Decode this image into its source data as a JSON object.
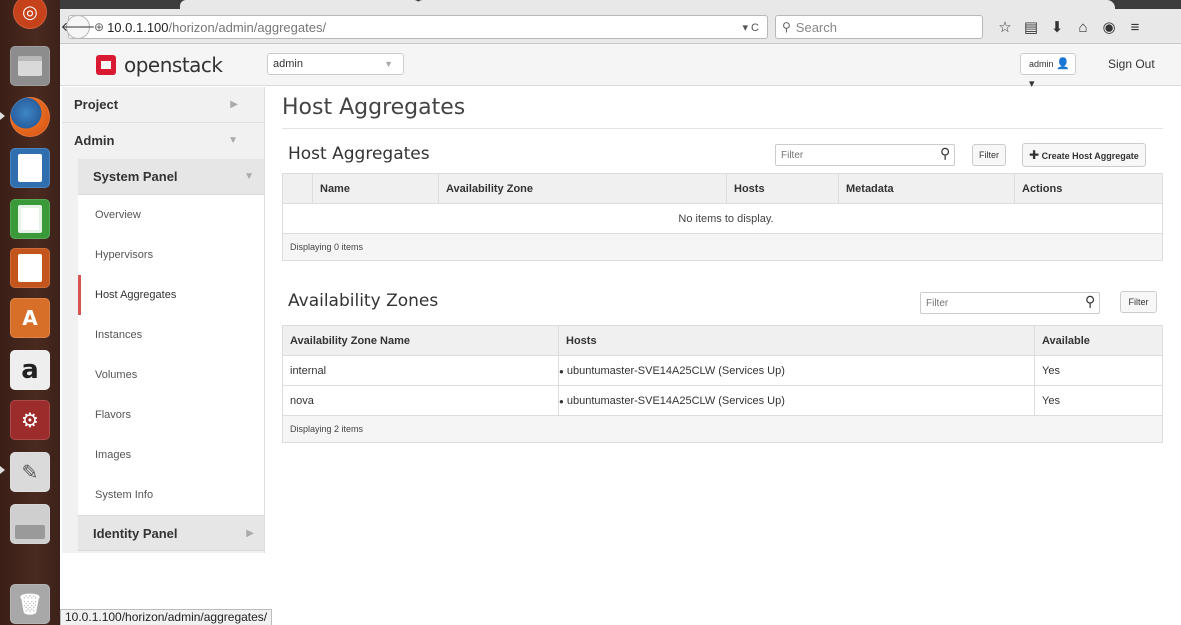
{
  "browser": {
    "url_host": "10.0.1.100",
    "url_path": "/horizon/admin/aggregates/",
    "search_placeholder": "Search",
    "status_url": "10.0.1.100/horizon/admin/aggregates/"
  },
  "header": {
    "logo_text": "openstack",
    "project": "admin",
    "user": "admin",
    "sign_out": "Sign Out"
  },
  "sidebar": {
    "project_label": "Project",
    "admin_label": "Admin",
    "system_panel_label": "System Panel",
    "links": [
      "Overview",
      "Hypervisors",
      "Host Aggregates",
      "Instances",
      "Volumes",
      "Flavors",
      "Images",
      "System Info"
    ],
    "active_index": 2,
    "identity_panel_label": "Identity Panel"
  },
  "main": {
    "page_title": "Host Aggregates",
    "aggregates": {
      "title": "Host Aggregates",
      "filter_placeholder": "Filter",
      "filter_button": "Filter",
      "create_button": "Create Host Aggregate",
      "columns": [
        "Name",
        "Availability Zone",
        "Hosts",
        "Metadata",
        "Actions"
      ],
      "empty_text": "No items to display.",
      "footer": "Displaying 0 items"
    },
    "zones": {
      "title": "Availability Zones",
      "filter_placeholder": "Filter",
      "filter_button": "Filter",
      "columns": [
        "Availability Zone Name",
        "Hosts",
        "Available"
      ],
      "rows": [
        {
          "name": "internal",
          "hosts": "ubuntumaster-SVE14A25CLW (Services Up)",
          "available": "Yes"
        },
        {
          "name": "nova",
          "hosts": "ubuntumaster-SVE14A25CLW (Services Up)",
          "available": "Yes"
        }
      ],
      "footer": "Displaying 2 items"
    }
  },
  "colors": {
    "accent_red": "#da1a32",
    "active_marker": "#d9534f",
    "launcher_bg": "#3a1f17"
  },
  "launcher_icons": [
    "ubuntu-dash-icon",
    "files-icon",
    "firefox-icon",
    "writer-icon",
    "calc-icon",
    "impress-icon",
    "software-center-icon",
    "amazon-icon",
    "system-settings-icon",
    "text-editor-icon",
    "drive-icon",
    "trash-icon"
  ]
}
